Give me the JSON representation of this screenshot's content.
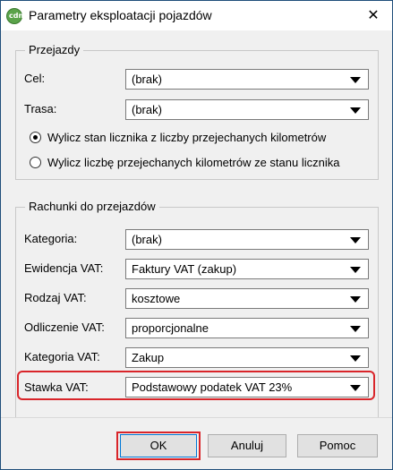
{
  "window": {
    "title": "Parametry eksploatacji pojazdów",
    "close_glyph": "✕",
    "app_icon": "cdn-logo-icon",
    "app_icon_text": "cdn"
  },
  "przejazdy": {
    "legend": "Przejazdy",
    "cel_label": "Cel:",
    "cel_value": "(brak)",
    "trasa_label": "Trasa:",
    "trasa_value": "(brak)",
    "radio1_label": "Wylicz stan licznika z liczby przejechanych kilometrów",
    "radio1_checked": true,
    "radio2_label": "Wylicz liczbę przejechanych kilometrów ze stanu licznika",
    "radio2_checked": false
  },
  "rachunki": {
    "legend": "Rachunki do przejazdów",
    "kategoria_label": "Kategoria:",
    "kategoria_value": "(brak)",
    "ewidencja_label": "Ewidencja VAT:",
    "ewidencja_value": "Faktury VAT (zakup)",
    "rodzaj_label": "Rodzaj VAT:",
    "rodzaj_value": "kosztowe",
    "odliczenie_label": "Odliczenie VAT:",
    "odliczenie_value": "proporcjonalne",
    "kategoria_vat_label": "Kategoria VAT:",
    "kategoria_vat_value": "Zakup",
    "stawka_label": "Stawka VAT:",
    "stawka_value": "Podstawowy podatek VAT 23%"
  },
  "buttons": {
    "ok": "OK",
    "anuluj": "Anuluj",
    "pomoc": "Pomoc"
  },
  "colors": {
    "highlight": "#d9252a",
    "accent": "#0078d7"
  }
}
